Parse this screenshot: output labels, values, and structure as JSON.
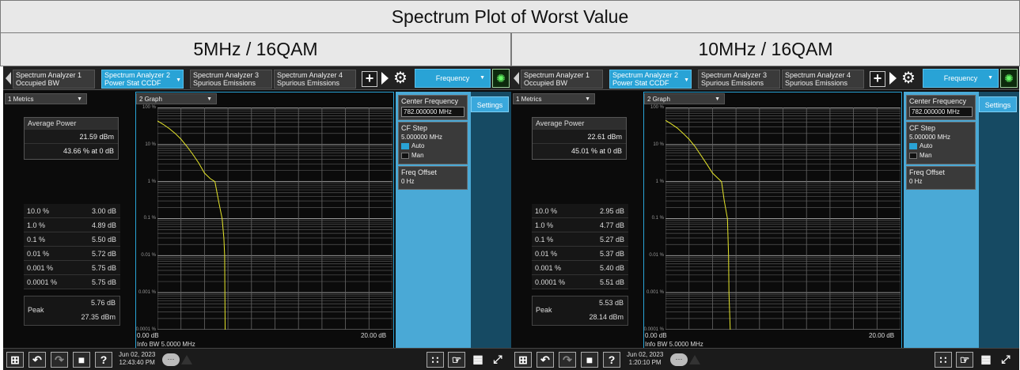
{
  "page_title": "Spectrum Plot of Worst Value",
  "screens": [
    {
      "header": "5MHz / 16QAM",
      "tabs": [
        {
          "line1": "Spectrum Analyzer 1",
          "line2": "Occupied BW"
        },
        {
          "line1": "Spectrum Analyzer 2",
          "line2": "Power Stat CCDF"
        },
        {
          "line1": "Spectrum Analyzer 3",
          "line2": "Spurious Emissions"
        },
        {
          "line1": "Spectrum Analyzer 4",
          "line2": "Spurious Emissions"
        }
      ],
      "menu_label": "Frequency",
      "metrics_title": "1 Metrics",
      "graph_title": "2 Graph",
      "avg_power_label": "Average Power",
      "avg_power_dbm": "21.59 dBm",
      "avg_power_pct": "43.66 % at 0 dB",
      "ccdf_rows": [
        {
          "pct": "10.0 %",
          "val": "3.00 dB"
        },
        {
          "pct": "1.0 %",
          "val": "4.89 dB"
        },
        {
          "pct": "0.1 %",
          "val": "5.50 dB"
        },
        {
          "pct": "0.01 %",
          "val": "5.72 dB"
        },
        {
          "pct": "0.001 %",
          "val": "5.75 dB"
        },
        {
          "pct": "0.0001 %",
          "val": "5.75 dB"
        }
      ],
      "peak_label": "Peak",
      "peak_db": "5.76 dB",
      "peak_dbm": "27.35 dBm",
      "y_labels": [
        "100 %",
        "10 %",
        "1 %",
        "0.1 %",
        "0.01 %",
        "0.001 %",
        "0.0001 %"
      ],
      "x_start": "0.00 dB",
      "x_end": "20.00 dB",
      "info_bw": "Info BW 5.0000 MHz",
      "settings_label": "Settings",
      "center_freq_label": "Center Frequency",
      "center_freq_value": "782.000000 MHz",
      "cf_step_label": "CF Step",
      "cf_step_value": "5.000000 MHz",
      "auto_label": "Auto",
      "man_label": "Man",
      "freq_offset_label": "Freq Offset",
      "freq_offset_value": "0 Hz",
      "date": "Jun 02, 2023",
      "time": "12:43:40 PM",
      "trace_color": "#e6e62a",
      "chart_data": {
        "type": "line",
        "xlabel": "dB",
        "ylabel": "%",
        "xlim": [
          0,
          20
        ],
        "ylim": [
          0.0001,
          100
        ],
        "y_scale": "log",
        "series": [
          {
            "name": "",
            "x": [
              0,
              0.5,
              1.0,
              1.5,
              2.0,
              2.5,
              3.0,
              3.5,
              4.0,
              4.5,
              4.89,
              5.2,
              5.5,
              5.65,
              5.72,
              5.76
            ],
            "y": [
              43.66,
              35,
              27,
              20,
              14,
              9,
              5.5,
              3.2,
              1.7,
              1.2,
              1.0,
              0.3,
              0.1,
              0.03,
              0.01,
              0.0001
            ]
          }
        ]
      }
    },
    {
      "header": "10MHz / 16QAM",
      "tabs": [
        {
          "line1": "Spectrum Analyzer 1",
          "line2": "Occupied BW"
        },
        {
          "line1": "Spectrum Analyzer 2",
          "line2": "Power Stat CCDF"
        },
        {
          "line1": "Spectrum Analyzer 3",
          "line2": "Spurious Emissions"
        },
        {
          "line1": "Spectrum Analyzer 4",
          "line2": "Spurious Emissions"
        }
      ],
      "menu_label": "Frequency",
      "metrics_title": "1 Metrics",
      "graph_title": "2 Graph",
      "avg_power_label": "Average Power",
      "avg_power_dbm": "22.61 dBm",
      "avg_power_pct": "45.01 % at 0 dB",
      "ccdf_rows": [
        {
          "pct": "10.0 %",
          "val": "2.95 dB"
        },
        {
          "pct": "1.0 %",
          "val": "4.77 dB"
        },
        {
          "pct": "0.1 %",
          "val": "5.27 dB"
        },
        {
          "pct": "0.01 %",
          "val": "5.37 dB"
        },
        {
          "pct": "0.001 %",
          "val": "5.40 dB"
        },
        {
          "pct": "0.0001 %",
          "val": "5.51 dB"
        }
      ],
      "peak_label": "Peak",
      "peak_db": "5.53 dB",
      "peak_dbm": "28.14 dBm",
      "y_labels": [
        "100 %",
        "10 %",
        "1 %",
        "0.1 %",
        "0.01 %",
        "0.001 %",
        "0.0001 %"
      ],
      "x_start": "0.00 dB",
      "x_end": "20.00 dB",
      "info_bw": "Info BW 5.0000 MHz",
      "settings_label": "Settings",
      "center_freq_label": "Center Frequency",
      "center_freq_value": "782.000000 MHz",
      "cf_step_label": "CF Step",
      "cf_step_value": "5.000000 MHz",
      "auto_label": "Auto",
      "man_label": "Man",
      "freq_offset_label": "Freq Offset",
      "freq_offset_value": "0 Hz",
      "date": "Jun 02, 2023",
      "time": "1:20:10 PM",
      "trace_color": "#e6e62a",
      "chart_data": {
        "type": "line",
        "xlabel": "dB",
        "ylabel": "%",
        "xlim": [
          0,
          20
        ],
        "ylim": [
          0.0001,
          100
        ],
        "y_scale": "log",
        "series": [
          {
            "name": "",
            "x": [
              0,
              0.5,
              1.0,
              1.5,
              2.0,
              2.5,
              2.95,
              3.5,
              4.0,
              4.5,
              4.77,
              5.0,
              5.27,
              5.37,
              5.4,
              5.51
            ],
            "y": [
              45.01,
              36,
              28,
              20,
              14,
              9,
              5.5,
              3.0,
              1.7,
              1.2,
              1.0,
              0.3,
              0.1,
              0.01,
              0.001,
              0.0001
            ]
          }
        ]
      }
    }
  ]
}
